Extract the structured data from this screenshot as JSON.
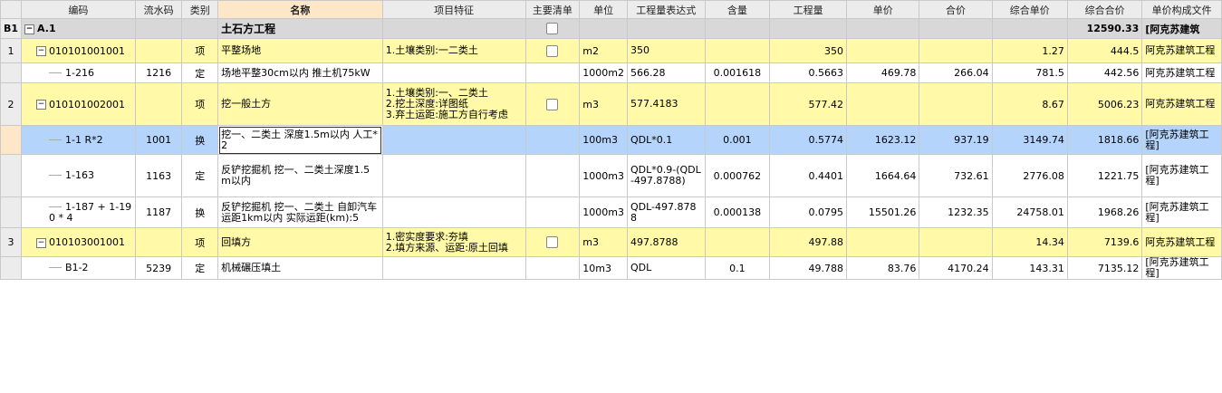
{
  "headers": [
    "",
    "编码",
    "流水码",
    "类别",
    "名称",
    "项目特征",
    "主要清单",
    "单位",
    "工程量表达式",
    "含量",
    "工程量",
    "单价",
    "合价",
    "综合单价",
    "综合合价",
    "单价构成文件"
  ],
  "section": {
    "rownum": "B1",
    "code": "A.1",
    "name": "土石方工程",
    "total": "12590.33",
    "file": "[阿克苏建筑"
  },
  "rows": [
    {
      "type": "item",
      "rownum": "1",
      "code": "010101001001",
      "cat": "项",
      "name": "平整场地",
      "feature": "1.土壤类别:一二类土",
      "unit": "m2",
      "expr": "350",
      "qty": "350",
      "unitprice": "1.27",
      "total": "444.5",
      "file": "阿克苏建筑工程"
    },
    {
      "type": "sub",
      "code": "1-216",
      "serial": "1216",
      "cat": "定",
      "name": "场地平整30cm以内 推土机75kW",
      "unit": "1000m2",
      "expr": "566.28",
      "content": "0.001618",
      "qty": "0.5663",
      "price": "469.78",
      "amount": "266.04",
      "unitprice": "781.5",
      "total": "442.56",
      "file": "阿克苏建筑工程"
    },
    {
      "type": "item",
      "rownum": "2",
      "code": "010101002001",
      "cat": "项",
      "name": "挖一般土方",
      "feature": "1.土壤类别:一、二类土\n2.挖土深度:详图纸\n3.弃土运距:施工方自行考虑",
      "unit": "m3",
      "expr": "577.4183",
      "qty": "577.42",
      "unitprice": "8.67",
      "total": "5006.23",
      "file": "阿克苏建筑工程"
    },
    {
      "type": "sel",
      "code": "1-1 R*2",
      "serial": "1001",
      "cat": "换",
      "name": "挖一、二类土 深度1.5m以内  人工*2",
      "unit": "100m3",
      "expr": "QDL*0.1",
      "content": "0.001",
      "qty": "0.5774",
      "price": "1623.12",
      "amount": "937.19",
      "unitprice": "3149.74",
      "total": "1818.66",
      "file": "[阿克苏建筑工程]"
    },
    {
      "type": "sub",
      "code": "1-163",
      "serial": "1163",
      "cat": "定",
      "name": "反铲挖掘机 挖一、二类土深度1.5m以内",
      "unit": "1000m3",
      "expr": "QDL*0.9-(QDL-497.8788)",
      "content": "0.000762",
      "qty": "0.4401",
      "price": "1664.64",
      "amount": "732.61",
      "unitprice": "2776.08",
      "total": "1221.75",
      "file": "[阿克苏建筑工程]"
    },
    {
      "type": "sub",
      "code": "1-187 + 1-190 * 4",
      "serial": "1187",
      "cat": "换",
      "name": "反铲挖掘机 挖一、二类土 自卸汽车运距1km以内  实际运距(km):5",
      "unit": "1000m3",
      "expr": "QDL-497.8788",
      "content": "0.000138",
      "qty": "0.0795",
      "price": "15501.26",
      "amount": "1232.35",
      "unitprice": "24758.01",
      "total": "1968.26",
      "file": "[阿克苏建筑工程]"
    },
    {
      "type": "item",
      "rownum": "3",
      "code": "010103001001",
      "cat": "项",
      "name": "回填方",
      "feature": "1.密实度要求:夯填\n2.填方来源、运距:原土回填",
      "unit": "m3",
      "expr": "497.8788",
      "qty": "497.88",
      "unitprice": "14.34",
      "total": "7139.6",
      "file": "阿克苏建筑工程"
    },
    {
      "type": "sub",
      "code": "B1-2",
      "serial": "5239",
      "cat": "定",
      "name": "机械碾压填土",
      "unit": "10m3",
      "expr": "QDL",
      "content": "0.1",
      "qty": "49.788",
      "price": "83.76",
      "amount": "4170.24",
      "unitprice": "143.31",
      "total": "7135.12",
      "file": "[阿克苏建筑工程]"
    }
  ]
}
